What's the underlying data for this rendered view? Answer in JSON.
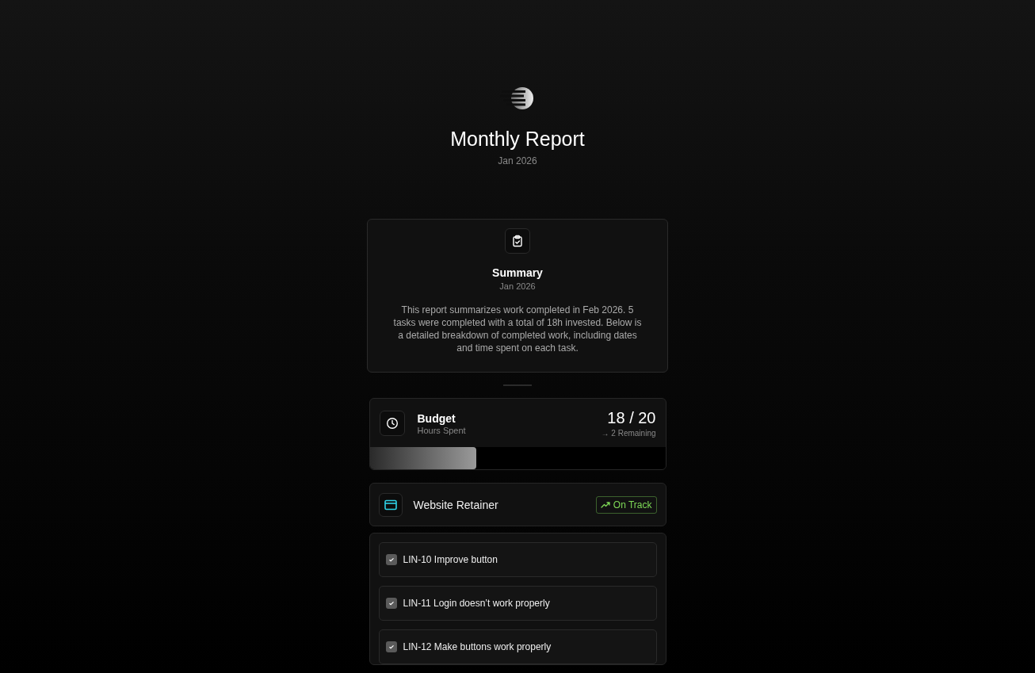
{
  "header": {
    "title": "Monthly Report",
    "subtitle": "Jan 2026"
  },
  "summary": {
    "title": "Summary",
    "date": "Jan 2026",
    "text": "This report summarizes work completed in Feb 2026. 5 tasks were completed with a total of 18h invested. Below is a detailed breakdown of completed work, including dates and time spent on each task."
  },
  "budget": {
    "title": "Budget",
    "subtitle": "Hours Spent",
    "value": "18 / 20",
    "remaining": "→ 2 Remaining",
    "level": 0.36
  },
  "project": {
    "name": "Website Retainer",
    "status": "On Track",
    "color": "#7ed957"
  },
  "tasks": [
    {
      "label": "LIN-10 Improve button",
      "checked": true
    },
    {
      "label": "LIN-11 Login doesn’t work properly",
      "checked": true
    },
    {
      "label": "LIN-12 Make buttons work properly",
      "checked": true
    }
  ]
}
